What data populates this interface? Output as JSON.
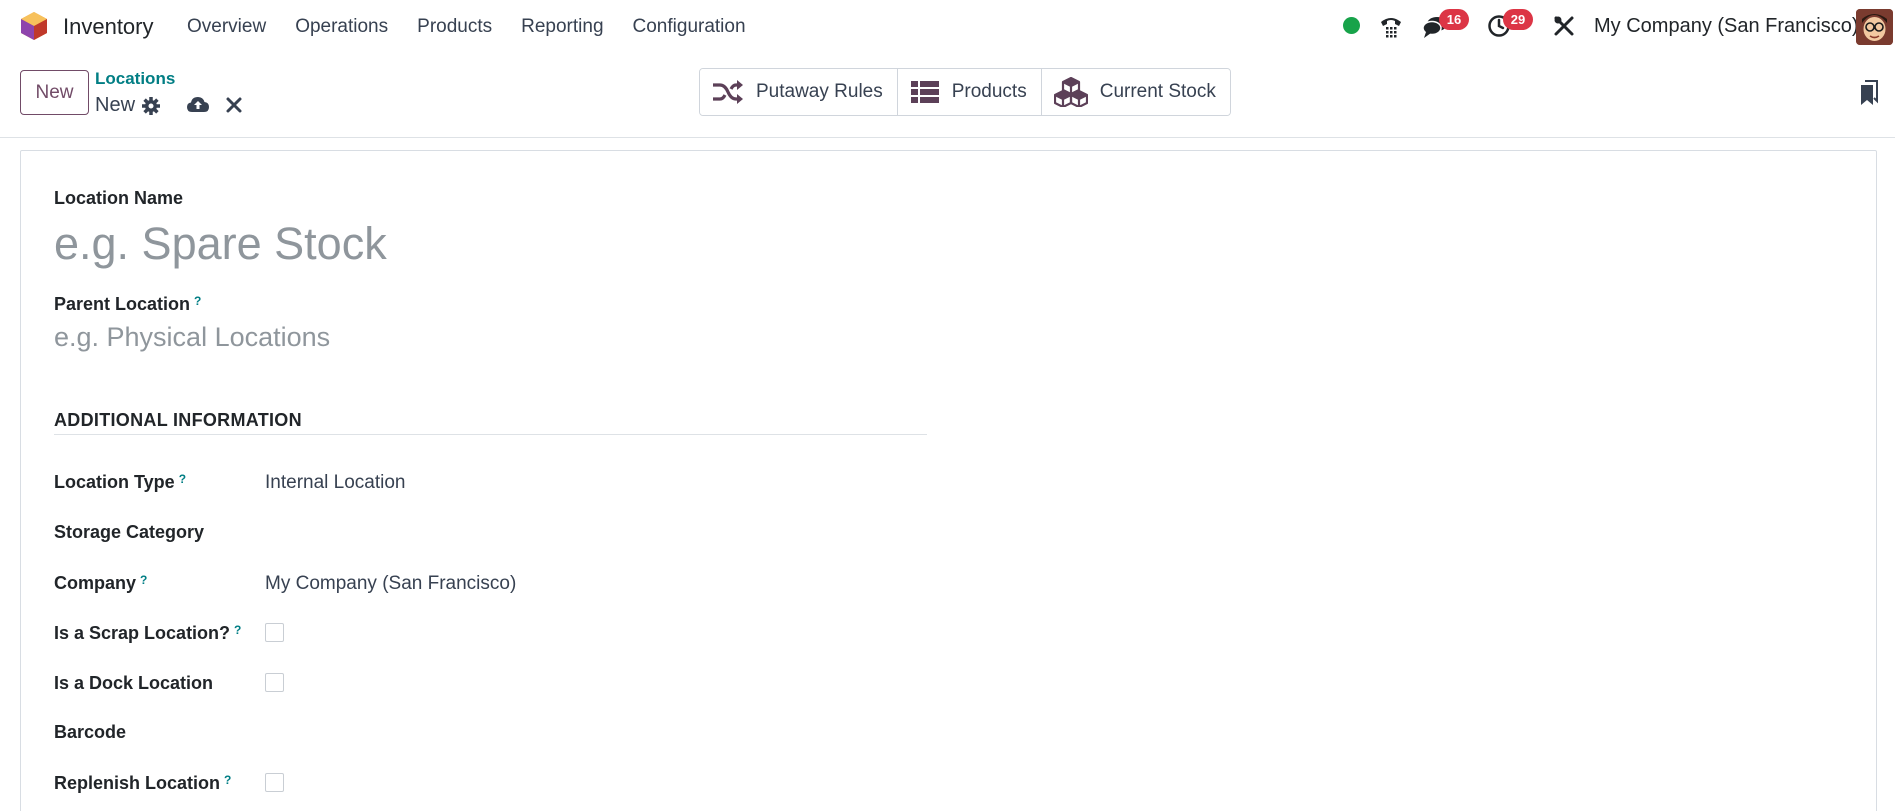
{
  "navbar": {
    "app_name": "Inventory",
    "menu": [
      "Overview",
      "Operations",
      "Products",
      "Reporting",
      "Configuration"
    ],
    "messages_count": "16",
    "activities_count": "29",
    "company": "My Company (San Francisco)"
  },
  "control": {
    "new_label": "New",
    "breadcrumb_parent": "Locations",
    "breadcrumb_current": "New",
    "smart_buttons": [
      "Putaway Rules",
      "Products",
      "Current Stock"
    ]
  },
  "form": {
    "location_name_label": "Location Name",
    "location_name_placeholder": "e.g. Spare Stock",
    "parent_location_label": "Parent Location",
    "parent_location_placeholder": "e.g. Physical Locations",
    "help_mark": "?",
    "section_title": "ADDITIONAL INFORMATION",
    "location_type_label": "Location Type",
    "location_type_value": "Internal Location",
    "storage_category_label": "Storage Category",
    "company_label": "Company",
    "company_value": "My Company (San Francisco)",
    "scrap_label": "Is a Scrap Location?",
    "dock_label": "Is a Dock Location",
    "barcode_label": "Barcode",
    "replenish_label": "Replenish Location"
  },
  "colors": {
    "brand": "#714b67",
    "link": "#017e84",
    "badge": "#dc3545",
    "presence": "#17a34a"
  }
}
